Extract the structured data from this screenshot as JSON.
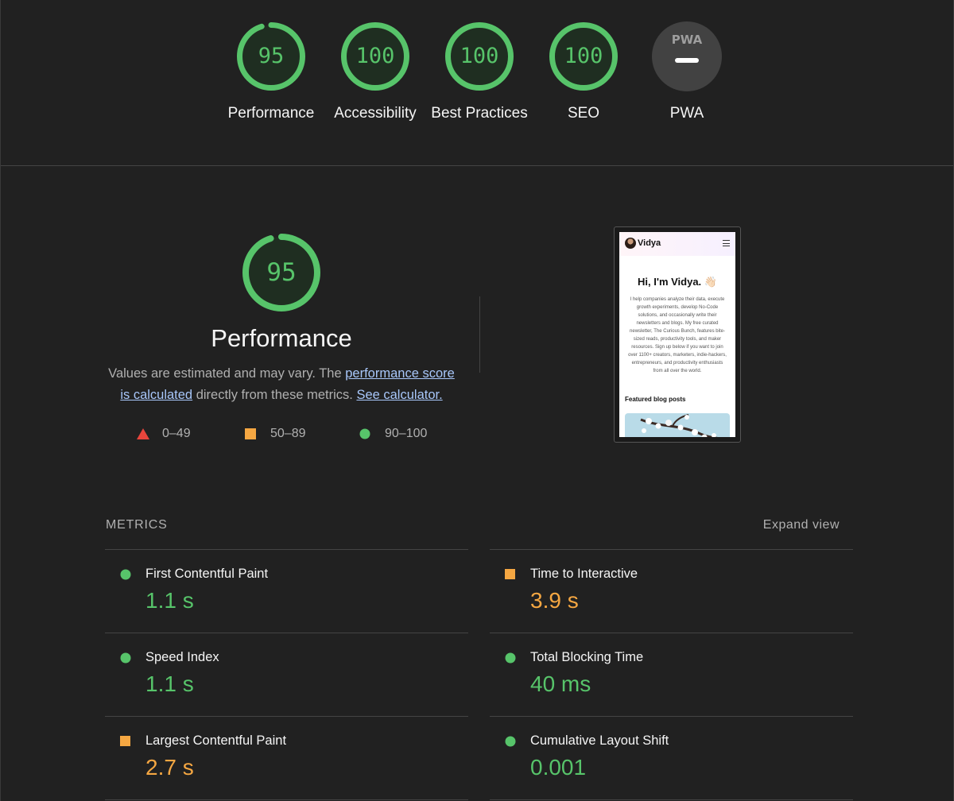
{
  "colors": {
    "pass": "#57c46a",
    "average": "#f5a742",
    "fail": "#e8453c",
    "link": "#a8c7fa",
    "background": "#212121"
  },
  "categories": [
    {
      "score": "95",
      "label": "Performance",
      "fraction": 0.95
    },
    {
      "score": "100",
      "label": "Accessibility",
      "fraction": 1.0
    },
    {
      "score": "100",
      "label": "Best Practices",
      "fraction": 1.0
    },
    {
      "score": "100",
      "label": "SEO",
      "fraction": 1.0
    },
    {
      "badge": "PWA",
      "label": "PWA"
    }
  ],
  "performance": {
    "score": "95",
    "fraction": 0.95,
    "title": "Performance",
    "desc_prefix": "Values are estimated and may vary. The ",
    "desc_link1": "performance score is calculated",
    "desc_middle": " directly from these metrics. ",
    "desc_link2": "See calculator.",
    "legend": [
      {
        "range": "0–49",
        "shape": "triangle"
      },
      {
        "range": "50–89",
        "shape": "square"
      },
      {
        "range": "90–100",
        "shape": "circle"
      }
    ]
  },
  "thumbnail": {
    "site_name": "Vidya",
    "hero": "Hi, I'm Vidya. 👋🏻",
    "body": "I help companies analyze their data, execute growth experiments, develop No-Code solutions, and occasionally write their newsletters and blogs. My free curated newsletter, The Curious Bunch, features bite-sized reads, productivity tools, and maker resources. Sign up below if you want to join over 1100+ creators, marketers, indie-hackers, entrepreneurs, and productivity enthusiasts from all over the world.",
    "featured": "Featured blog posts"
  },
  "metrics": {
    "header": "METRICS",
    "expand": "Expand view",
    "items": [
      {
        "name": "First Contentful Paint",
        "value": "1.1 s",
        "status": "pass"
      },
      {
        "name": "Time to Interactive",
        "value": "3.9 s",
        "status": "average"
      },
      {
        "name": "Speed Index",
        "value": "1.1 s",
        "status": "pass"
      },
      {
        "name": "Total Blocking Time",
        "value": "40 ms",
        "status": "pass"
      },
      {
        "name": "Largest Contentful Paint",
        "value": "2.7 s",
        "status": "average"
      },
      {
        "name": "Cumulative Layout Shift",
        "value": "0.001",
        "status": "pass"
      }
    ]
  }
}
